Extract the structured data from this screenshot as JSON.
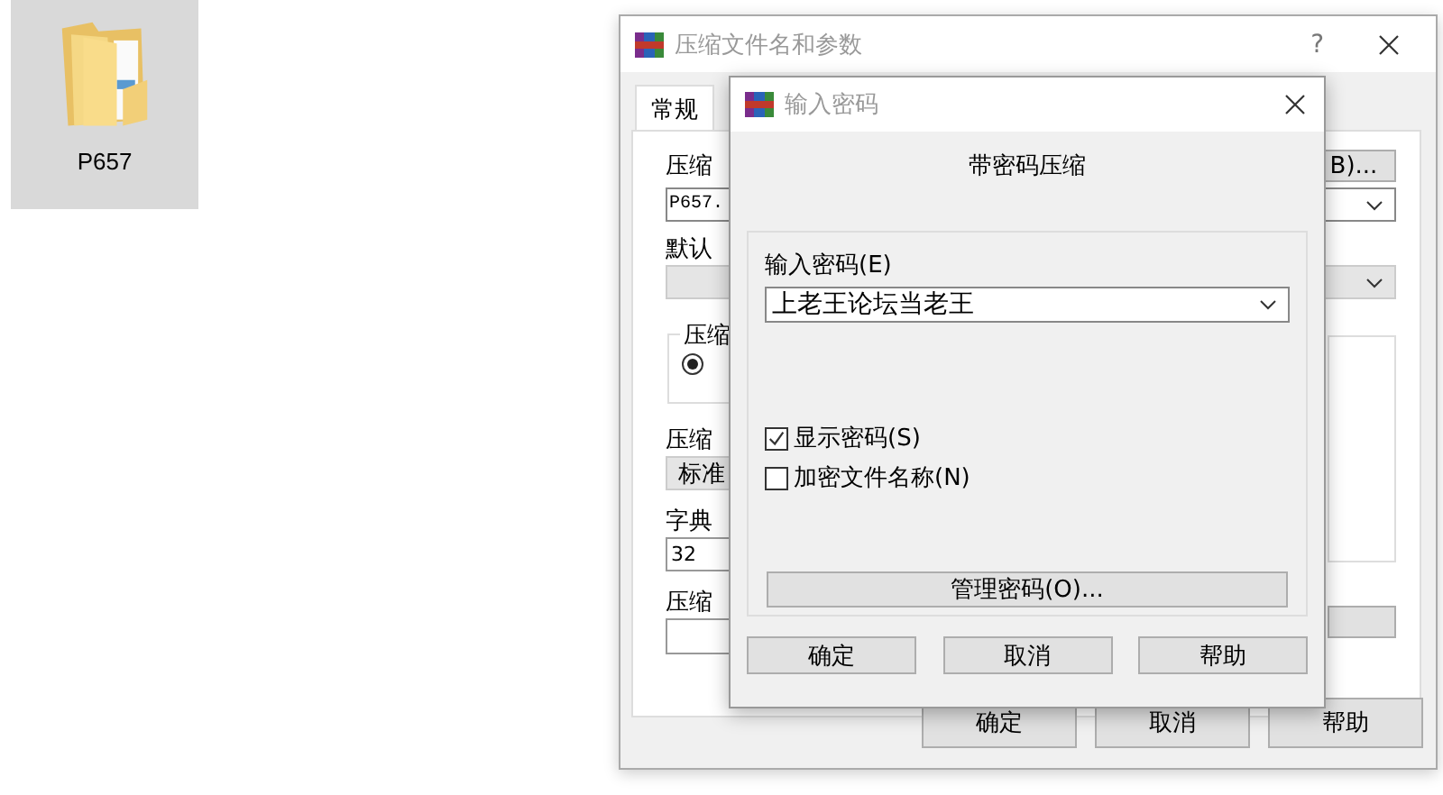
{
  "desktop_icon": {
    "label": "P657",
    "selected": true
  },
  "main_window": {
    "title": "压缩文件名和参数",
    "help": "?",
    "tabs": [
      {
        "label": "常规",
        "selected": true
      }
    ],
    "archive_name_label": "压缩",
    "archive_name": "P657.",
    "browse_button": "B)...",
    "profile_label": "默认",
    "format_group_label": "压缩",
    "format_radio": {
      "selected": true
    },
    "method_label": "压缩",
    "method": "标准",
    "dict_label": "字典",
    "dict": "32",
    "split_label": "压缩",
    "buttons": [
      "确定",
      "取消",
      "帮助"
    ]
  },
  "password_dialog": {
    "title": "输入密码",
    "heading": "带密码压缩",
    "password_label": "输入密码(E)",
    "password": "上老王论坛当老王",
    "options": [
      {
        "label": "显示密码(S)",
        "checked": true
      },
      {
        "label": "加密文件名称(N)",
        "checked": false
      }
    ],
    "manage_button": "管理密码(O)...",
    "buttons": [
      "确定",
      "取消",
      "帮助"
    ]
  }
}
